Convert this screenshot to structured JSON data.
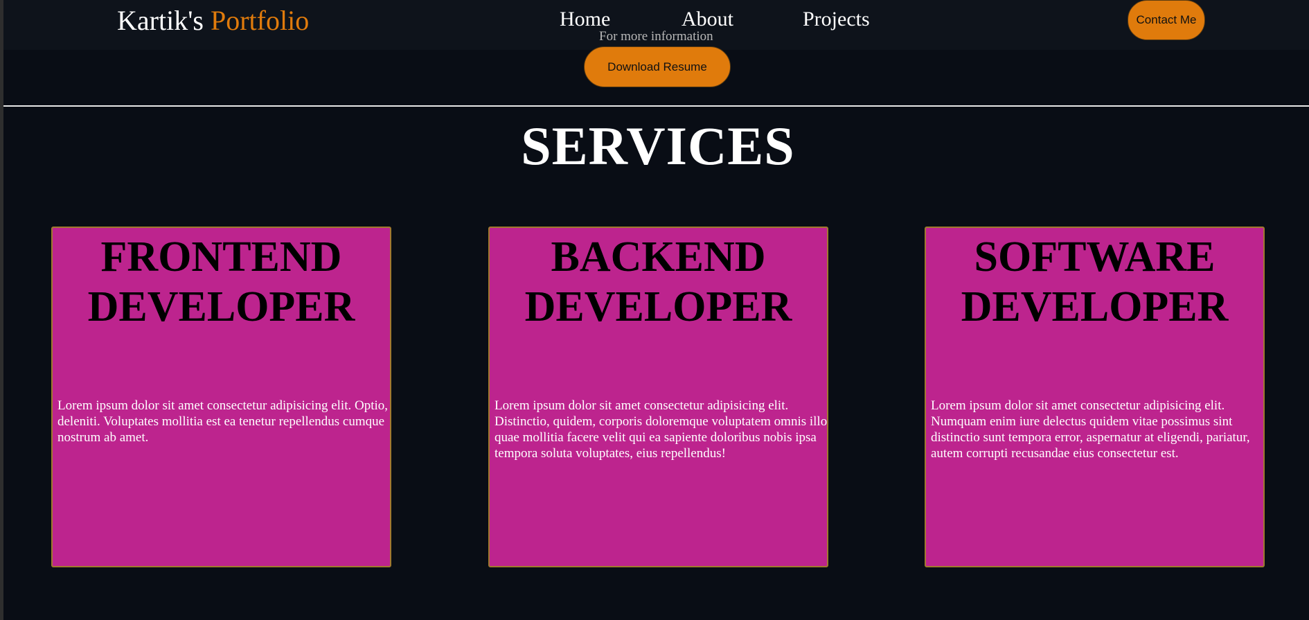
{
  "navbar": {
    "brand_name": "Kartik's",
    "brand_accent": "Portfolio",
    "links": [
      "Home",
      "About",
      "Projects"
    ],
    "contact_label": "Contact Me"
  },
  "hero": {
    "info_text": "For more information",
    "resume_label": "Download Resume"
  },
  "services": {
    "title": "SERVICES",
    "cards": [
      {
        "title": "FRONTEND DEVELOPER",
        "text": "Lorem ipsum dolor sit amet consectetur adipisicing elit. Optio, deleniti. Voluptates mollitia est ea tenetur repellendus cumque nostrum ab amet."
      },
      {
        "title": "BACKEND DEVELOPER",
        "text": "Lorem ipsum dolor sit amet consectetur adipisicing elit. Distinctio, quidem, corporis doloremque voluptatem omnis illo quae mollitia facere velit qui ea sapiente doloribus nobis ipsa tempora soluta voluptates, eius repellendus!"
      },
      {
        "title": "SOFTWARE DEVELOPER",
        "text": "Lorem ipsum dolor sit amet consectetur adipisicing elit. Numquam enim iure delectus quidem vitae possimus sint distinctio sunt tempora error, aspernatur at eligendi, pariatur, autem corrupti recusandae eius consectetur est."
      }
    ]
  },
  "colors": {
    "accent": "#e07b0c",
    "card_background": "#bd248e",
    "page_background": "#090d15"
  }
}
